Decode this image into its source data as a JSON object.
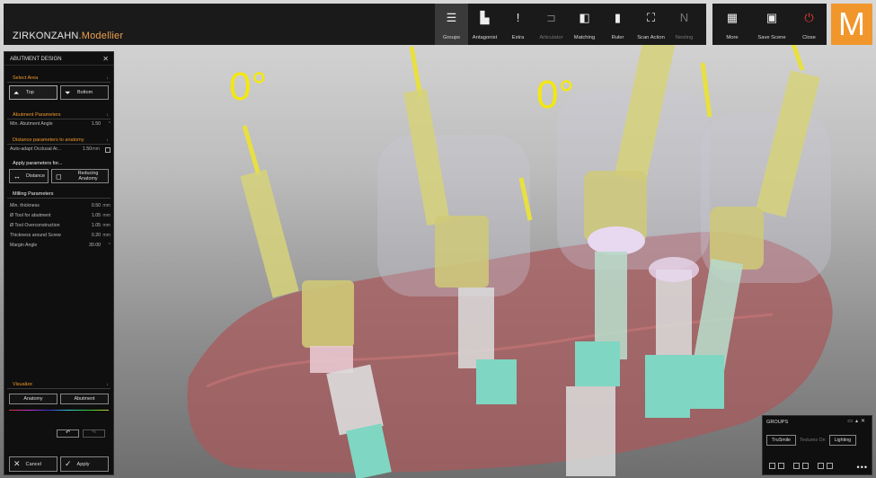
{
  "brand": {
    "name": "ZIRKONZAHN",
    "suffix": ".Modellier",
    "logo_letter": "M"
  },
  "toolbar": [
    {
      "label": "Groups",
      "icon": "menu-icon",
      "active": true
    },
    {
      "label": "Antagonist",
      "icon": "antagonist-icon"
    },
    {
      "label": "Extra",
      "icon": "exclamation-icon"
    },
    {
      "label": "Articulator",
      "icon": "articulator-icon",
      "disabled": true
    },
    {
      "label": "Matching",
      "icon": "matching-icon"
    },
    {
      "label": "Ruler",
      "icon": "ruler-icon"
    },
    {
      "label": "Scan Action",
      "icon": "scan-icon"
    },
    {
      "label": "Nesting",
      "icon": "nesting-icon",
      "disabled": true
    }
  ],
  "toolbar_right": [
    {
      "label": "More",
      "icon": "more-icon"
    },
    {
      "label": "Save Scene",
      "icon": "save-icon"
    },
    {
      "label": "Close",
      "icon": "power-icon"
    }
  ],
  "viewport": {
    "angle_label_1": "0°",
    "angle_label_2": "0°"
  },
  "panel": {
    "title": "ABUTMENT DESIGN",
    "select_area": {
      "heading": "Select Area",
      "top": "Top",
      "bottom": "Bottom"
    },
    "abutment_params": {
      "heading": "Abutment Parameters",
      "min_angle_label": "Min. Abutment Angle",
      "min_angle_value": "1.50"
    },
    "distance": {
      "heading": "Distance parameters to anatomy",
      "auto_label": "Auto-adapt Occlusal Ar...",
      "auto_value": "1.50",
      "auto_unit": "mm"
    },
    "apply": {
      "heading": "Apply parameters for...",
      "distance": "Distance",
      "reducing": "Reducing Anatomy"
    },
    "milling": {
      "heading": "Milling Parameters",
      "rows": [
        {
          "label": "Min. thickness",
          "value": "0.50",
          "unit": "mm"
        },
        {
          "label": "Ø Tool for abutment",
          "value": "1.05",
          "unit": "mm"
        },
        {
          "label": "Ø Tool Overconstruction",
          "value": "1.05",
          "unit": "mm"
        },
        {
          "label": "Thickness around Screw",
          "value": "0.20",
          "unit": "mm"
        },
        {
          "label": "Margin Angle",
          "value": "30.00",
          "unit": "°"
        }
      ]
    },
    "visualize": {
      "heading": "Visualize",
      "anatomy": "Anatomy",
      "abutment": "Abutment"
    },
    "cancel": "Cancel",
    "apply_btn": "Apply"
  },
  "groups": {
    "title": "GROUPS",
    "trusmile": "TruSmile",
    "textures": "Textures On",
    "lighting": "Lighting"
  },
  "colors": {
    "accent": "#f0962b",
    "angle": "#f4e80b"
  }
}
